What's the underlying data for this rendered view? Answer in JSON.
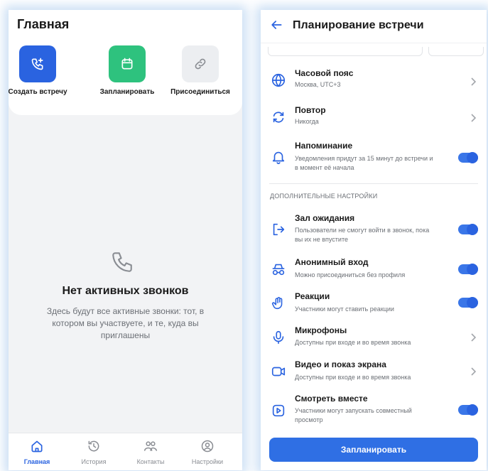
{
  "home": {
    "title": "Главная",
    "actions": [
      {
        "label": "Создать встречу",
        "icon": "phone-plus-icon",
        "color": "#2a63e0"
      },
      {
        "label": "Запланировать",
        "icon": "calendar-icon",
        "color": "#2ec27e"
      },
      {
        "label": "Присоединиться",
        "icon": "link-icon",
        "color": "#eceef1"
      }
    ],
    "empty": {
      "icon": "phone-icon",
      "title": "Нет активных звонков",
      "description": "Здесь будут все активные звонки: тот, в котором вы участвуете, и те, куда вы приглашены"
    },
    "tabs": [
      {
        "label": "Главная",
        "icon": "home-icon",
        "active": true
      },
      {
        "label": "История",
        "icon": "history-icon",
        "active": false
      },
      {
        "label": "Контакты",
        "icon": "contacts-icon",
        "active": false
      },
      {
        "label": "Настройки",
        "icon": "settings-icon",
        "active": false
      }
    ]
  },
  "planning": {
    "title": "Планирование встречи",
    "rows": [
      {
        "title": "Часовой пояс",
        "subtitle": "Москва, UTC+3",
        "control": "chevron",
        "icon": "globe-icon"
      },
      {
        "title": "Повтор",
        "subtitle": "Никогда",
        "control": "chevron",
        "icon": "repeat-icon"
      },
      {
        "title": "Напоминание",
        "subtitle": "Уведомления придут за 15 минут до встречи и в момент её начала",
        "control": "toggle",
        "on": true,
        "icon": "bell-icon"
      }
    ],
    "section_title": "ДОПОЛНИТЕЛЬНЫЕ НАСТРОЙКИ",
    "extra_rows": [
      {
        "title": "Зал ожидания",
        "subtitle": "Пользователи не смогут войти в звонок, пока вы их не впустите",
        "control": "toggle",
        "on": true,
        "icon": "enter-icon"
      },
      {
        "title": "Анонимный вход",
        "subtitle": "Можно присоединиться без профиля",
        "control": "toggle",
        "on": true,
        "icon": "incognito-icon"
      },
      {
        "title": "Реакции",
        "subtitle": "Участники могут ставить реакции",
        "control": "toggle",
        "on": true,
        "icon": "hand-wave-icon"
      },
      {
        "title": "Микрофоны",
        "subtitle": "Доступны при входе и во время звонка",
        "control": "chevron",
        "icon": "microphone-icon"
      },
      {
        "title": "Видео и показ экрана",
        "subtitle": "Доступны при входе и во время звонка",
        "control": "chevron",
        "icon": "video-icon"
      },
      {
        "title": "Смотреть вместе",
        "subtitle": "Участники могут запускать совместный просмотр",
        "control": "toggle",
        "on": true,
        "icon": "play-square-icon"
      }
    ],
    "button_label": "Запланировать"
  },
  "colors": {
    "accent": "#2a63e0",
    "green": "#2ec27e",
    "muted": "#6b6f75"
  }
}
